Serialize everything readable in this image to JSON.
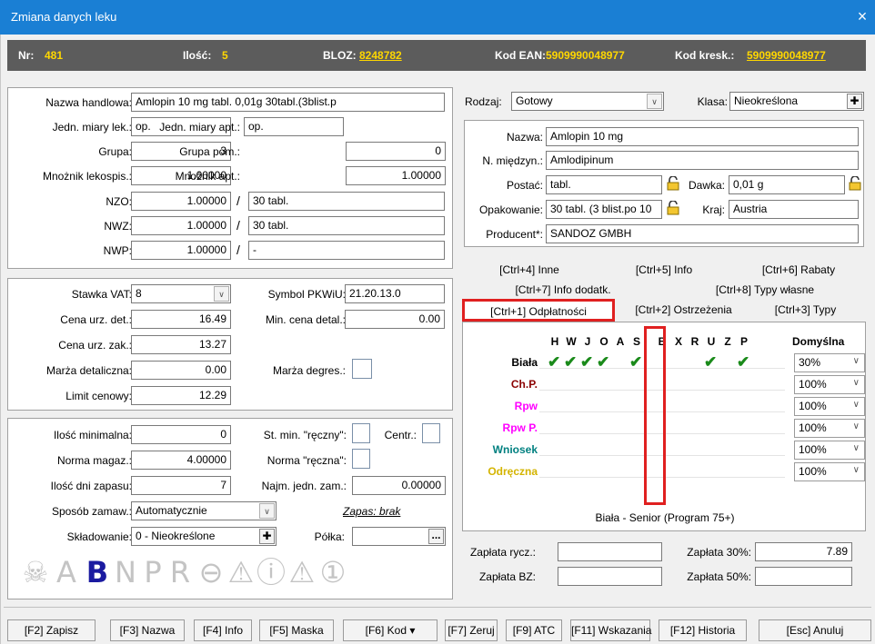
{
  "window": {
    "title": "Zmiana danych leku",
    "close": "×"
  },
  "infobar": {
    "nr_label": "Nr:",
    "nr": "481",
    "ilosc_label": "Ilość:",
    "ilosc": "5",
    "bloz_label": "BLOZ:",
    "bloz": "8248782",
    "ean_label": "Kod EAN:",
    "ean": "5909990048977",
    "kresk_label": "Kod kresk.:",
    "kresk": "5909990048977"
  },
  "left": {
    "nazwa_handlowa_label": "Nazwa handlowa:",
    "nazwa_handlowa": "Amlopin 10 mg tabl. 0,01g 30tabl.(3blist.p",
    "jedn_lek_label": "Jedn. miary lek.:",
    "jedn_lek": "op.",
    "jedn_apt_label": "Jedn. miary apt.:",
    "jedn_apt": "op.",
    "grupa_label": "Grupa:",
    "grupa": "3",
    "grupa_pom_label": "Grupa pom.:",
    "grupa_pom": "0",
    "mn_lek_label": "Mnożnik lekospis.:",
    "mn_lek": "1.00000",
    "mn_apt_label": "Mnożnik apt.:",
    "mn_apt": "1.00000",
    "nzo_label": "NZO:",
    "nzo": "1.00000",
    "nzo2": "30 tabl.",
    "nwz_label": "NWZ:",
    "nwz": "1.00000",
    "nwz2": "30 tabl.",
    "nwp_label": "NWP:",
    "nwp": "1.00000",
    "nwp2": "-",
    "slash": "/",
    "vat_label": "Stawka VAT:",
    "vat": "8",
    "pkwiu_label": "Symbol PKWiU:",
    "pkwiu": "21.20.13.0",
    "cena_det_label": "Cena urz. det.:",
    "cena_det": "16.49",
    "min_cena_label": "Min. cena detal.:",
    "min_cena": "0.00",
    "cena_zak_label": "Cena urz. zak.:",
    "cena_zak": "13.27",
    "marza_label": "Marża detaliczna:",
    "marza": "0.00",
    "marza_degres_label": "Marża degres.:",
    "limit_label": "Limit cenowy:",
    "limit": "12.29",
    "ilosc_min_label": "Ilość minimalna:",
    "ilosc_min": "0",
    "st_min_label": "St. min. \"ręczny\":",
    "centr_label": "Centr.:",
    "norma_label": "Norma magaz.:",
    "norma": "4.00000",
    "norma_r_label": "Norma \"ręczna\":",
    "dni_label": "Ilość dni zapasu:",
    "dni": "7",
    "najm_label": "Najm. jedn. zam.:",
    "najm": "0.00000",
    "sposob_label": "Sposób zamaw.:",
    "sposob": "Automatycznie",
    "zapas": "Zapas: brak",
    "sklad_label": "Składowanie:",
    "sklad": "0 - Nieokreślone",
    "polka_label": "Półka:",
    "polka_btn": "..."
  },
  "symbols": [
    "☠",
    "A",
    "B",
    "N",
    "P",
    "R",
    "⊖",
    "⚠",
    "ⓘ",
    "⚠",
    "①"
  ],
  "right": {
    "rodzaj_label": "Rodzaj:",
    "rodzaj": "Gotowy",
    "klasa_label": "Klasa:",
    "klasa": "Nieokreślona",
    "nazwa_label": "Nazwa:",
    "nazwa": "Amlopin 10 mg",
    "nmiedz_label": "N. międzyn.:",
    "nmiedz": "Amlodipinum",
    "postac_label": "Postać:",
    "postac": "tabl.",
    "dawka_label": "Dawka:",
    "dawka": "0,01 g",
    "opak_label": "Opakowanie:",
    "opak": "30 tabl. (3 blist.po 10",
    "kraj_label": "Kraj:",
    "kraj": "Austria",
    "producent_label": "Producent*:",
    "producent": "SANDOZ GMBH"
  },
  "tabs": {
    "row1": [
      "[Ctrl+4] Inne",
      "[Ctrl+5] Info",
      "[Ctrl+6] Rabaty"
    ],
    "row2": [
      "[Ctrl+7] Info dodatk.",
      "[Ctrl+8] Typy własne"
    ],
    "row3": [
      "[Ctrl+1] Odpłatności",
      "[Ctrl+2] Ostrzeżenia",
      "[Ctrl+3] Typy"
    ]
  },
  "grid": {
    "cols": [
      "H",
      "W",
      "J",
      "O",
      "A",
      "S",
      "B",
      "X",
      "R",
      "U",
      "Z",
      "P"
    ],
    "default_label": "Domyślna",
    "rows": [
      {
        "label": "Biała",
        "color": "#000000",
        "checks": [
          "H",
          "W",
          "J",
          "O",
          "S",
          "U",
          "P"
        ],
        "pct": "30%"
      },
      {
        "label": "Ch.P.",
        "color": "#8b0000",
        "checks": [],
        "pct": "100%"
      },
      {
        "label": "Rpw",
        "color": "#ff00ff",
        "checks": [],
        "pct": "100%"
      },
      {
        "label": "Rpw P.",
        "color": "#ff00ff",
        "checks": [],
        "pct": "100%"
      },
      {
        "label": "Wniosek",
        "color": "#008080",
        "checks": [],
        "pct": "100%"
      },
      {
        "label": "Odręczna",
        "color": "#d4b400",
        "checks": [],
        "pct": "100%"
      }
    ],
    "caption": "Biała - Senior (Program 75+)"
  },
  "payments": {
    "rycz_label": "Zapłata rycz.:",
    "rycz": "",
    "p30_label": "Zapłata 30%:",
    "p30": "7.89",
    "bz_label": "Zapłata BZ:",
    "bz": "",
    "p50_label": "Zapłata 50%:",
    "p50": ""
  },
  "footer": [
    "[F2] Zapisz",
    "[F3] Nazwa",
    "[F4] Info",
    "[F5] Maska",
    "[F6] Kod ▾",
    "[F7] Zeruj",
    "[F9] ATC",
    "[F11] Wskazania",
    "[F12] Historia",
    "[Esc] Anuluj"
  ]
}
